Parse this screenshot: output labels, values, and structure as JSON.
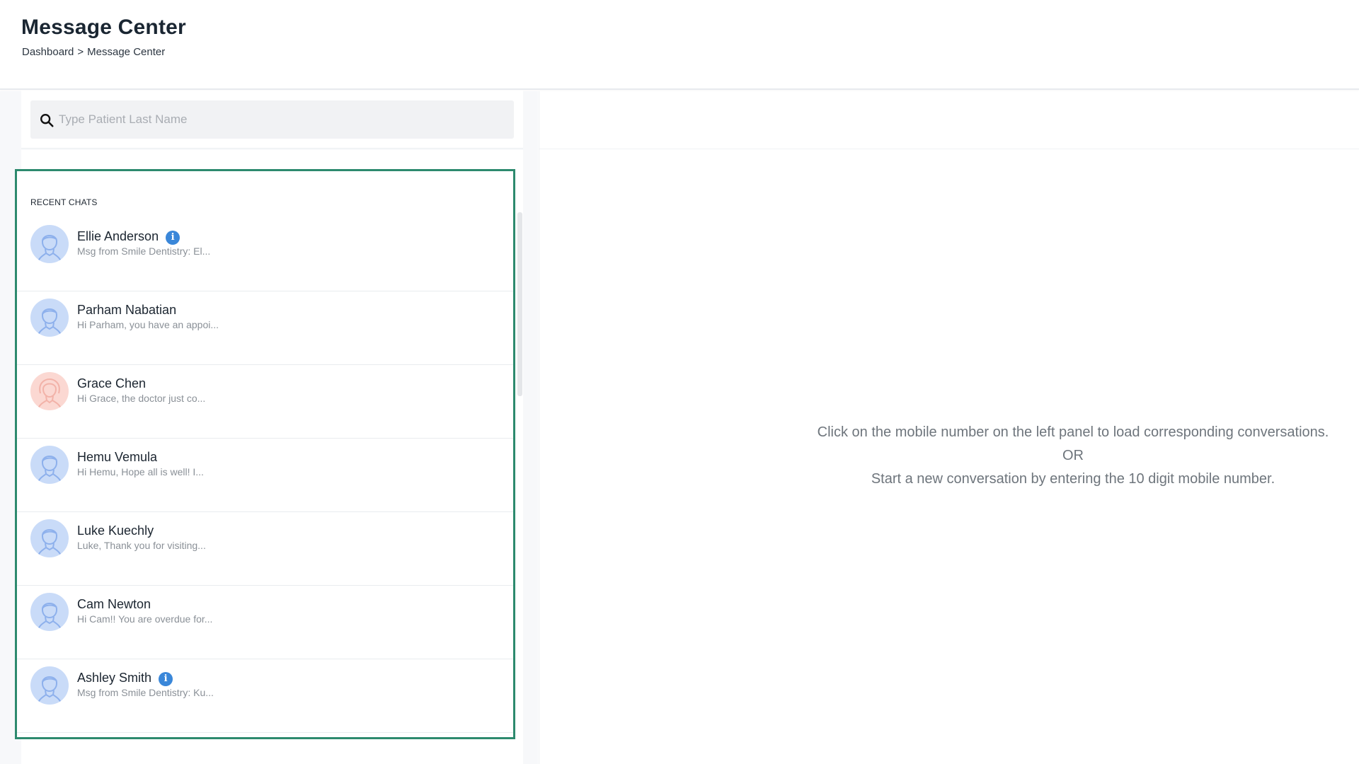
{
  "header": {
    "title": "Message Center",
    "breadcrumb": [
      "Dashboard",
      "Message Center"
    ],
    "breadcrumb_separator": ">"
  },
  "search": {
    "placeholder": "Type Patient Last Name",
    "value": ""
  },
  "recent_chats": {
    "label": "RECENT CHATS",
    "items": [
      {
        "name": "Ellie Anderson",
        "preview": "Msg from Smile Dentistry: El...",
        "avatar": "male-avatar-icon",
        "info": true
      },
      {
        "name": "Parham Nabatian",
        "preview": "Hi Parham, you have an appoi...",
        "avatar": "male-avatar-icon",
        "info": false
      },
      {
        "name": "Grace Chen",
        "preview": "Hi Grace, the doctor just co...",
        "avatar": "female-avatar-icon",
        "info": false
      },
      {
        "name": "Hemu Vemula",
        "preview": "Hi Hemu, Hope all is well! I...",
        "avatar": "male-avatar-icon",
        "info": false
      },
      {
        "name": "Luke Kuechly",
        "preview": "Luke, Thank you for visiting...",
        "avatar": "male-avatar-icon",
        "info": false
      },
      {
        "name": "Cam Newton",
        "preview": "Hi Cam!! You are overdue for...",
        "avatar": "male-avatar-icon",
        "info": false
      },
      {
        "name": "Ashley Smith",
        "preview": "Msg from Smile Dentistry: Ku...",
        "avatar": "male-avatar-icon",
        "info": true
      }
    ],
    "info_glyph": "i"
  },
  "empty_state": {
    "line1": "Click on the mobile number on the left panel to load corresponding conversations.",
    "line2": "OR",
    "line3": "Start a new conversation by entering the 10 digit mobile number."
  },
  "colors": {
    "highlight_border": "#2d8a6e",
    "info_badge": "#3a87d9",
    "male_avatar_bg": "#c9dbf8",
    "female_avatar_bg": "#fbd8d2"
  }
}
